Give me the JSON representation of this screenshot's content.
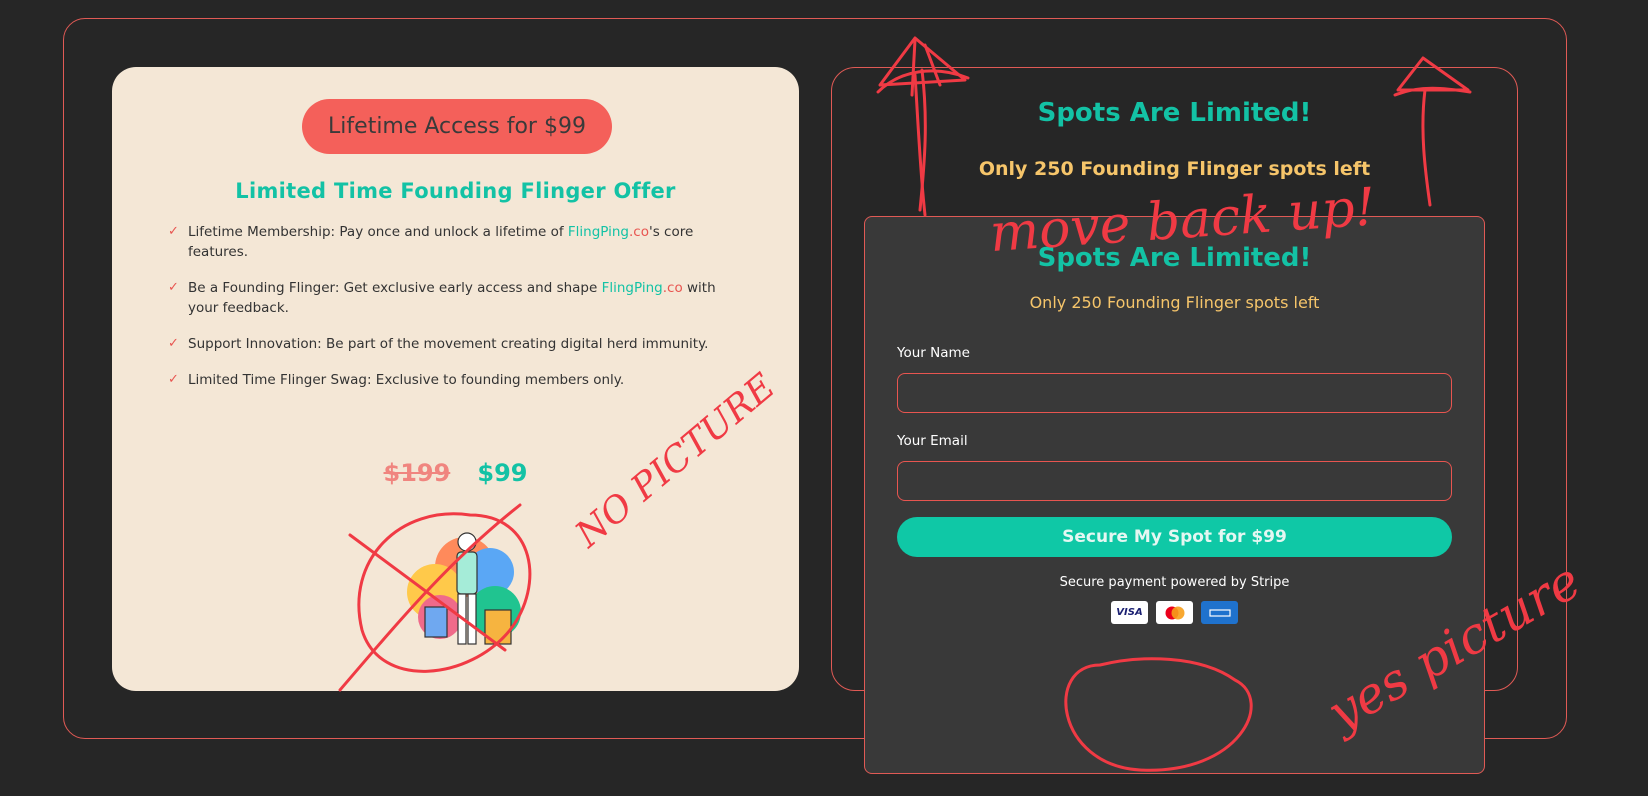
{
  "colors": {
    "background": "#262626",
    "accent_red": "#e85550",
    "teal": "#13c2a5",
    "yellow": "#f6c56a",
    "cream": "#f4e7d6",
    "card_dark": "#393939",
    "ink": "#f03a44"
  },
  "offer": {
    "pill_label": "Lifetime Access for $99",
    "title": "Limited Time Founding Flinger Offer",
    "features": [
      {
        "before": "Lifetime Membership: Pay once and unlock a lifetime of ",
        "brand_main": "FlingPing",
        "brand_tld": ".co",
        "after": "'s core features."
      },
      {
        "before": "Be a Founding Flinger: Get exclusive early access and shape ",
        "brand_main": "FlingPing",
        "brand_tld": ".co",
        "after": " with your feedback."
      },
      {
        "text": "Support Innovation: Be part of the movement creating digital herd immunity."
      },
      {
        "text": "Limited Time Flinger Swag: Exclusive to founding members only."
      }
    ],
    "old_price": "$199",
    "new_price": "$99",
    "illustration_icon": "shopping-woman-illustration"
  },
  "spots_back": {
    "title": "Spots Are Limited!",
    "subtitle": "Only 250 Founding Flinger spots left"
  },
  "form": {
    "title": "Spots Are Limited!",
    "subtitle": "Only 250 Founding Flinger spots left",
    "name_label": "Your Name",
    "name_value": "",
    "email_label": "Your Email",
    "email_value": "",
    "submit_label": "Secure My Spot for $99",
    "stripe_note": "Secure payment powered by Stripe",
    "payment_icons": [
      "visa-icon",
      "mastercard-icon",
      "amex-icon"
    ],
    "visa_text": "VISA"
  },
  "annotations": {
    "move_back_up": "move back up!",
    "no_picture": "NO PICTURE",
    "yes_picture": "yes picture"
  }
}
